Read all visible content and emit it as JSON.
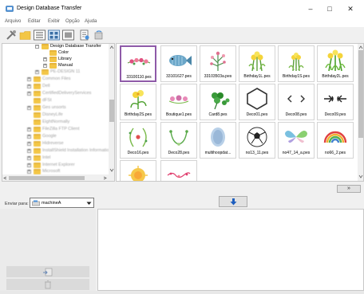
{
  "window": {
    "title": "Design Database Transfer",
    "minimize": "–",
    "maximize": "□",
    "close": "✕"
  },
  "menu": [
    "Arquivo",
    "Editar",
    "Exibir",
    "Opção",
    "Ajuda"
  ],
  "tree": {
    "root": "Design Database Transfer",
    "children": [
      "Color",
      "Library",
      "Manual"
    ],
    "blurred_items": [
      "PE-DESIGN 11",
      "Common Files",
      "Dell",
      "CertifiedDeliveryServices",
      "dFSt",
      "Ges unsorts",
      "DisneyLife",
      "EightNormally",
      "FileZilla FTP Client",
      "Google",
      "Hidreverse",
      "InstallShield Installation Information",
      "Intel",
      "Internet Explorer",
      "Microsoft"
    ]
  },
  "designs": [
    "33100110.pes",
    "33101627.pes",
    "33103503a.pes",
    "Birthday1L.pes",
    "Birthday1S.pes",
    "Birthday2L.pes",
    "Birthday2S.pes",
    "Boutique1.pes",
    "Card8.pes",
    "Deco01.pes",
    "Deco08.pes",
    "Deco09.pes",
    "Deco16.pes",
    "Deco28.pes",
    "multihoopdat...",
    "no13_11.pes",
    "no47_14_a.pes",
    "no66_2.pes",
    "",
    ""
  ],
  "selected_design_index": 0,
  "send": {
    "label": "Enviar para:",
    "destination": "machineA"
  },
  "colors": {
    "selection_border": "#8e5aa8",
    "arrow_blue": "#1f5fbf",
    "folder": "#f3c646"
  },
  "icons": {
    "app": "database-transfer-icon",
    "toolbar": [
      "tools-icon",
      "folder-icon",
      "list-view-icon",
      "thumbnail-view-icon",
      "large-thumbnail-view-icon",
      "properties-icon",
      "refresh-icon"
    ],
    "transfer": "down-arrow-icon",
    "collapse": "chevron-double-down-icon",
    "left_pane": [
      "send-to-card-icon",
      "delete-icon"
    ]
  }
}
